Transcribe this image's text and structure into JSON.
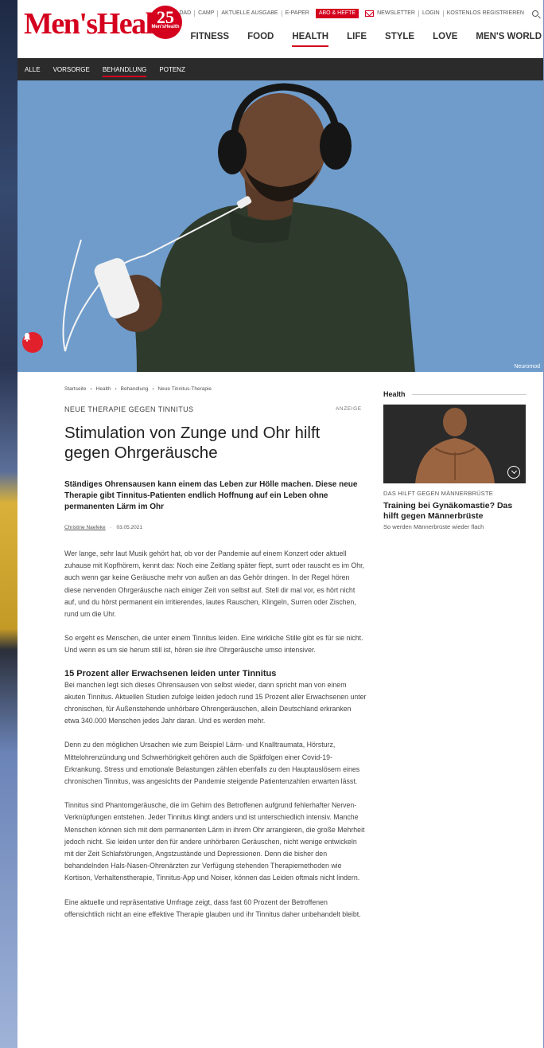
{
  "header": {
    "logo": "Men'sHealth",
    "badge_number": "25",
    "badge_sub": "Men'sHealth",
    "topbar": [
      "DAD",
      "CAMP",
      "AKTUELLE AUSGABE",
      "E-PAPER"
    ],
    "abo_label": "ABO & HEFTE",
    "newsletter": "NEWSLETTER",
    "login": "LOGIN",
    "register": "KOSTENLOS REGISTRIEREN",
    "nav": [
      "FITNESS",
      "FOOD",
      "HEALTH",
      "LIFE",
      "STYLE",
      "LOVE",
      "MEN'S WORLD"
    ],
    "nav_active": "HEALTH",
    "brand_color": "#d4001e"
  },
  "subnav": {
    "items": [
      "ALLE",
      "VORSORGE",
      "BEHANDLUNG",
      "POTENZ"
    ],
    "active": "BEHANDLUNG"
  },
  "hero": {
    "credit": "Neuromod",
    "bell_icon": "bell-icon"
  },
  "article": {
    "breadcrumb": [
      "Startseite",
      "Health",
      "Behandlung",
      "Neue Tinnitus-Therapie"
    ],
    "breadcrumb_sep": "›",
    "kicker": "NEUE THERAPIE GEGEN TINNITUS",
    "anzeige": "ANZEIGE",
    "title": "Stimulation von Zunge und Ohr hilft gegen Ohrgeräusche",
    "lead": "Ständiges Ohrensausen kann einem das Leben zur Hölle machen. Diese neue Therapie gibt Tinnitus-Patienten endlich Hoffnung auf ein Leben ohne permanenten Lärm im Ohr",
    "author": "Christine Naefeke",
    "date": "03.05.2021",
    "byline_sep": "·",
    "p1": "Wer lange, sehr laut Musik gehört hat, ob vor der Pandemie auf einem Konzert oder aktuell zuhause mit Kopfhörern, kennt das: Noch eine Zeitlang später fiept, surrt oder rauscht es im Ohr, auch wenn gar keine Geräusche mehr von außen an das Gehör dringen. In der Regel hören diese nervenden Ohrgeräusche nach einiger Zeit von selbst auf. Stell dir mal vor, es hört nicht auf, und du hörst permanent ein irritierendes, lautes Rauschen, Klingeln, Surren oder Zischen, rund um die Uhr.",
    "p2": "So ergeht es Menschen, die unter einem Tinnitus leiden. Eine wirkliche Stille gibt es für sie nicht. Und wenn es um sie herum still ist, hören sie ihre Ohrgeräusche umso intensiver.",
    "h2": "15 Prozent aller Erwachsenen leiden unter Tinnitus",
    "p3": "Bei manchen legt sich dieses Ohrensausen von selbst wieder, dann spricht man von einem akuten Tinnitus. Aktuellen Studien zufolge leiden jedoch rund 15 Prozent aller Erwachsenen unter chronischen, für Außenstehende unhörbare Ohrengeräuschen, allein Deutschland erkranken etwa 340.000 Menschen jedes Jahr daran. Und es werden mehr.",
    "p4": "Denn zu den möglichen Ursachen wie zum Beispiel Lärm- und Knalltraumata, Hörsturz, Mittelohrenzündung und Schwerhörigkeit gehören auch die Spätfolgen einer Covid-19-Erkrankung. Stress und emotionale Belastungen zählen ebenfalls zu den Hauptauslösern eines chronischen Tinnitus, was angesichts der Pandemie steigende Patientenzahlen erwarten lässt.",
    "p5": "Tinnitus sind Phantomgeräusche, die im Gehirn des Betroffenen aufgrund fehlerhafter Nerven-Verknüpfungen entstehen. Jeder Tinnitus klingt anders und ist unterschiedlich intensiv. Manche Menschen können sich mit dem permanenten Lärm in ihrem Ohr arrangieren, die große Mehrheit jedoch nicht. Sie leiden unter den für andere unhörbaren Geräuschen, nicht wenige entwickeln mit der Zeit Schlafstörungen, Angstzustände und Depressionen. Denn die bisher den behandelnden Hals-Nasen-Ohrenärzten zur Verfügung stehenden Therapiemethoden wie Kortison, Verhaltenstherapie, Tinnitus-App und Noiser, können das Leiden oftmals nicht lindern.",
    "p6": "Eine aktuelle und repräsentative Umfrage zeigt, dass fast 60 Prozent der Betroffenen offensichtlich nicht an eine effektive Therapie glauben und ihr Tinnitus daher unbehandelt bleibt."
  },
  "sidebar": {
    "heading": "Health",
    "kicker": "DAS HILFT GEGEN MÄNNERBRÜSTE",
    "title": "Training bei Gynäkomastie? Das hilft gegen Männerbrüste",
    "subtitle": "So werden Männerbrüste wieder flach",
    "download_icon": "download-icon"
  }
}
